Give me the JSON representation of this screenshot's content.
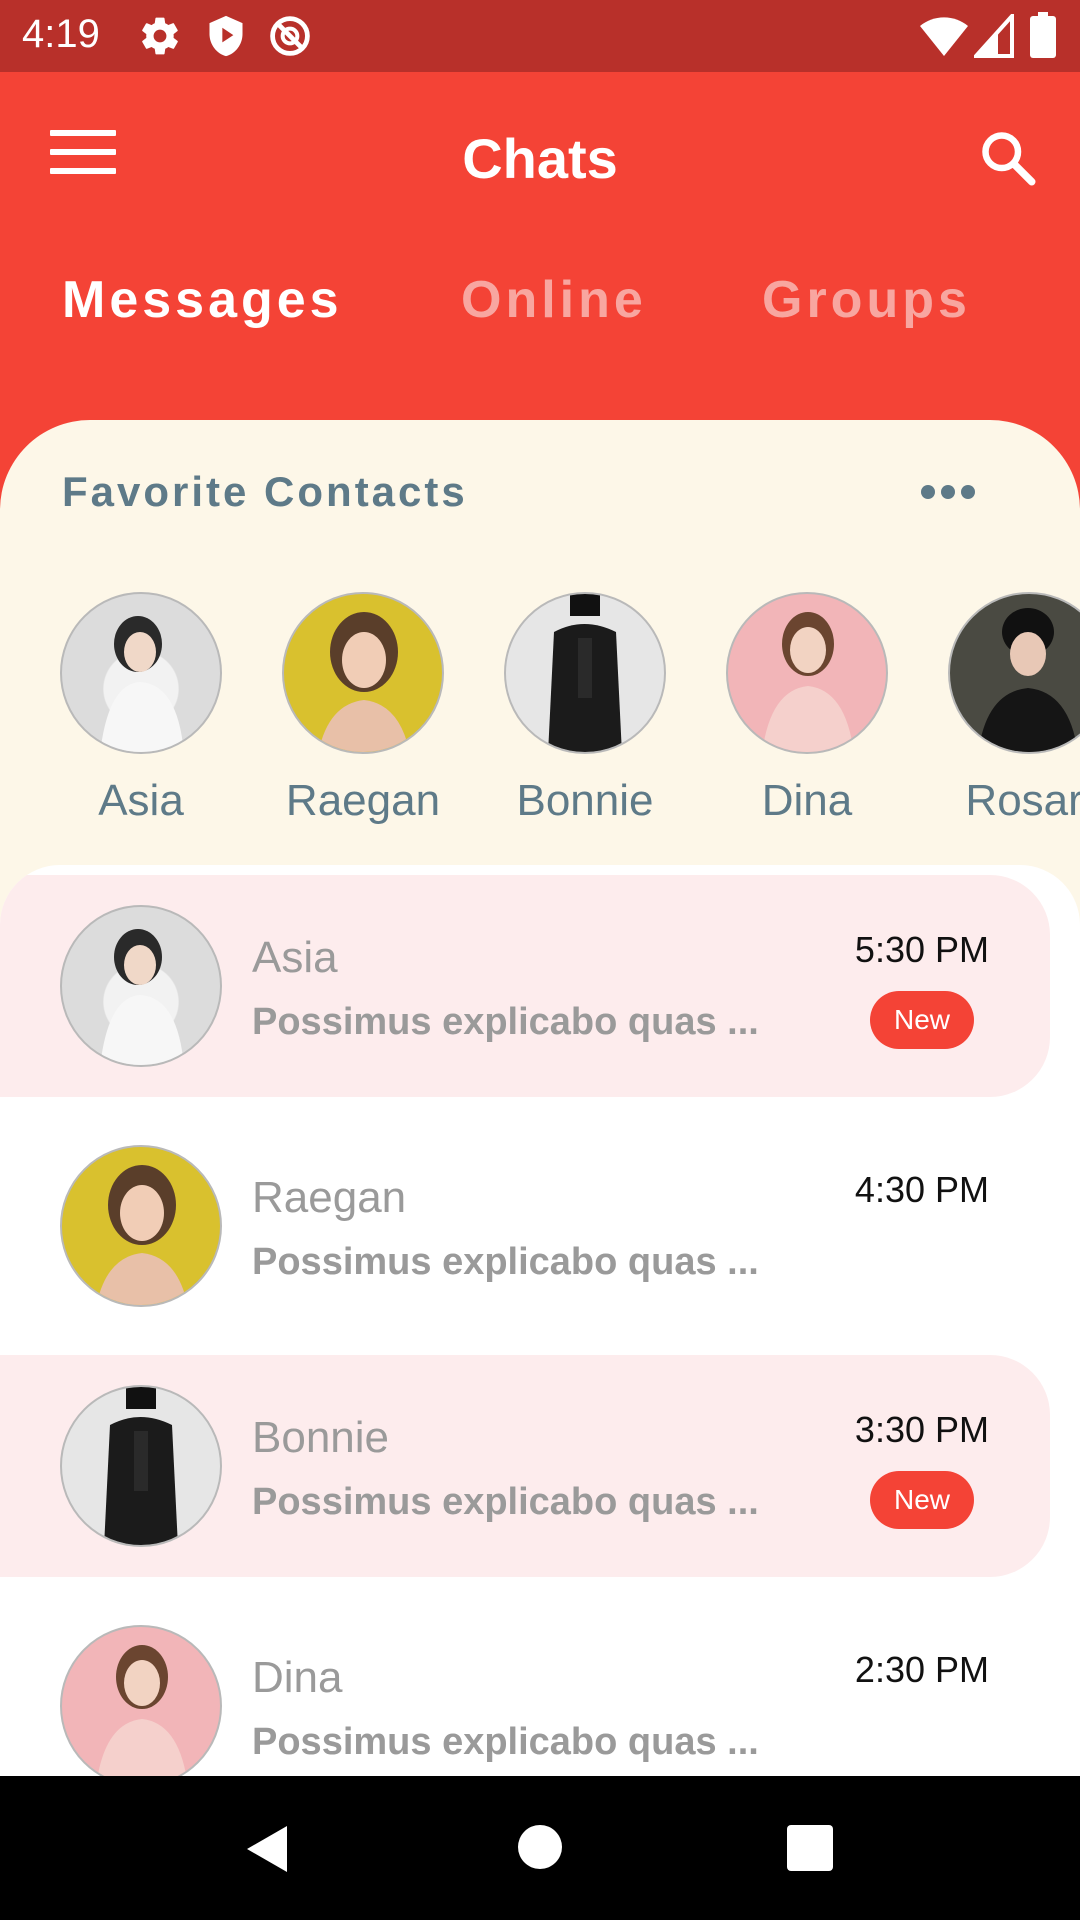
{
  "status_bar": {
    "time": "4:19",
    "left_icons": [
      "settings-icon",
      "shield-play-icon",
      "no-sync-icon"
    ],
    "right_icons": [
      "wifi-icon",
      "cell-signal-icon",
      "battery-icon"
    ]
  },
  "app_bar": {
    "title": "Chats",
    "menu_icon": "menu-icon",
    "search_icon": "search-icon"
  },
  "tabs": [
    {
      "label": "Messages",
      "active": true
    },
    {
      "label": "Online",
      "active": false
    },
    {
      "label": "Groups",
      "active": false
    }
  ],
  "favorites": {
    "title": "Favorite Contacts",
    "more_icon": "more-horizontal-icon",
    "contacts": [
      {
        "name": "Asia"
      },
      {
        "name": "Raegan"
      },
      {
        "name": "Bonnie"
      },
      {
        "name": "Dina"
      },
      {
        "name": "Rosari"
      }
    ]
  },
  "chats": [
    {
      "name": "Asia",
      "preview": "Possimus explicabo quas ...",
      "time": "5:30 PM",
      "badge": "New",
      "unread": true
    },
    {
      "name": "Raegan",
      "preview": "Possimus explicabo quas ...",
      "time": "4:30 PM",
      "badge": "",
      "unread": false
    },
    {
      "name": "Bonnie",
      "preview": "Possimus explicabo quas ...",
      "time": "3:30 PM",
      "badge": "New",
      "unread": true
    },
    {
      "name": "Dina",
      "preview": "Possimus explicabo quas ...",
      "time": "2:30 PM",
      "badge": "",
      "unread": false
    }
  ],
  "nav_bar": {
    "icons": [
      "back-icon",
      "home-icon",
      "recents-icon"
    ]
  },
  "colors": {
    "primary": "#f44336",
    "status_bar": "#b8302a",
    "favorites_bg": "#fdf7e8",
    "unread_bg": "#fdeced",
    "muted_text": "#5e7a88"
  }
}
